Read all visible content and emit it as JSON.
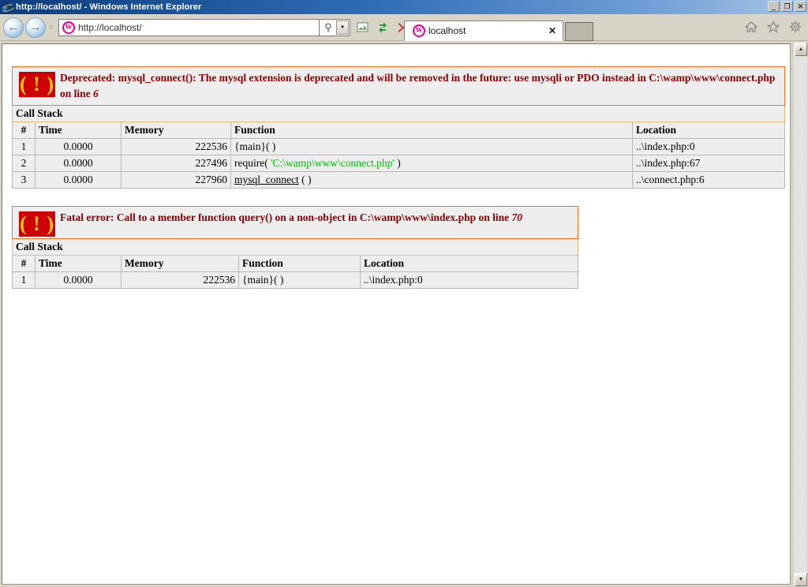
{
  "window": {
    "title": "http://localhost/ - Windows Internet Explorer",
    "app_icon": "ie-logo-icon",
    "minimize_label": "_",
    "restore_label": "❐",
    "close_label": "✕"
  },
  "toolbar": {
    "back_icon": "←",
    "forward_icon": "→",
    "recent_pages_icon": "▽",
    "address_value": "http://localhost/",
    "address_favicon": "wamp-favicon",
    "search_icon": "⚲",
    "address_dropdown_icon": "▼",
    "compatibility_view_icon": "⛰",
    "refresh_icon": "↺",
    "stop_icon": "✕",
    "home_icon": "⌂",
    "favorites_icon": "☆",
    "tools_icon": "⚙"
  },
  "tabs": {
    "active_tab_title": "localhost",
    "active_tab_favicon": "wamp-favicon",
    "close_label": "✕",
    "new_tab_label": ""
  },
  "scrollbar": {
    "up_arrow": "▲",
    "down_arrow": "▼"
  },
  "errors": [
    {
      "icon": "warning-icon",
      "icon_glyph": "( ! )",
      "severity": "Deprecated:",
      "message": "Deprecated: mysql_connect(): The mysql extension is deprecated and will be removed in the future: use mysqli or PDO instead in C:\\wamp\\www\\connect.php on line ",
      "message_part1": "Deprecated: mysql_connect(): The mysql extension is deprecated and will be removed in the future: use mysqli or PDO instead in C:\\wamp\\www\\connect.php on line",
      "line_number": "6",
      "callstack_label": "Call Stack",
      "columns": [
        "#",
        "Time",
        "Memory",
        "Function",
        "Location"
      ],
      "rows": [
        {
          "num": "1",
          "time": "0.0000",
          "memory": "222536",
          "function_plain": "{main}( )",
          "function_type": "plain",
          "location": "..\\index.php:0"
        },
        {
          "num": "2",
          "time": "0.0000",
          "memory": "227496",
          "function_prefix": "require( ",
          "function_string": "'C:\\wamp\\www\\connect.php'",
          "function_suffix": " )",
          "function_type": "require",
          "location": "..\\index.php:67"
        },
        {
          "num": "3",
          "time": "0.0000",
          "memory": "227960",
          "function_link": "mysql_connect",
          "function_suffix": " ( )",
          "function_type": "link",
          "location": "..\\connect.php:6"
        }
      ]
    },
    {
      "icon": "warning-icon",
      "icon_glyph": "( ! )",
      "severity": "Fatal error:",
      "message_part1": "Fatal error: Call to a member function query() on a non-object in C:\\wamp\\www\\index.php on line",
      "line_number": "70",
      "callstack_label": "Call Stack",
      "columns": [
        "#",
        "Time",
        "Memory",
        "Function",
        "Location"
      ],
      "rows": [
        {
          "num": "1",
          "time": "0.0000",
          "memory": "222536",
          "function_plain": "{main}( )",
          "function_type": "plain",
          "location": "..\\index.php:0"
        }
      ]
    }
  ],
  "colors": {
    "error_header_bg": "#f47421",
    "error_header_text": "#8b0000",
    "callstack_bg": "#eebb77",
    "table_bg": "#eeeeee",
    "icon_bg": "#cc0000",
    "icon_fg": "#ffd000",
    "string_literal": "#00bb00",
    "titlebar_start": "#0c3c7c",
    "titlebar_end": "#a9c6e6",
    "favicon_accent": "#ec008c"
  }
}
